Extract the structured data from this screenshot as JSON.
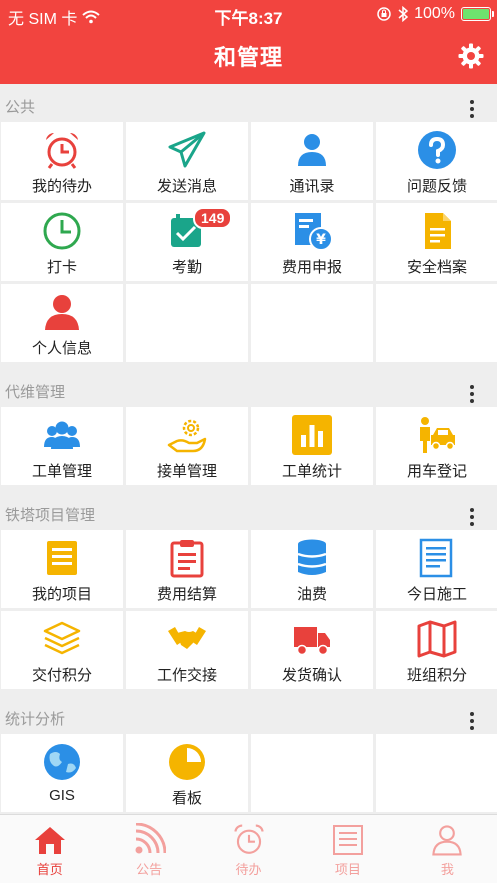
{
  "status_bar": {
    "carrier": "无 SIM 卡",
    "time": "下午8:37",
    "battery": "100%"
  },
  "header": {
    "title": "和管理"
  },
  "sections": [
    {
      "title": "公共",
      "items": [
        {
          "label": "我的待办",
          "icon": "alarm-clock-icon"
        },
        {
          "label": "发送消息",
          "icon": "paper-plane-icon"
        },
        {
          "label": "通讯录",
          "icon": "contact-person-icon"
        },
        {
          "label": "问题反馈",
          "icon": "question-icon"
        },
        {
          "label": "打卡",
          "icon": "clock-icon"
        },
        {
          "label": "考勤",
          "icon": "attendance-calendar-icon",
          "badge": "149"
        },
        {
          "label": "费用申报",
          "icon": "expense-report-icon"
        },
        {
          "label": "安全档案",
          "icon": "document-icon"
        },
        {
          "label": "个人信息",
          "icon": "person-icon"
        }
      ]
    },
    {
      "title": "代维管理",
      "items": [
        {
          "label": "工单管理",
          "icon": "group-icon"
        },
        {
          "label": "接单管理",
          "icon": "hand-gear-icon"
        },
        {
          "label": "工单统计",
          "icon": "bar-chart-icon"
        },
        {
          "label": "用车登记",
          "icon": "car-person-icon"
        }
      ]
    },
    {
      "title": "铁塔项目管理",
      "items": [
        {
          "label": "我的项目",
          "icon": "project-list-icon"
        },
        {
          "label": "费用结算",
          "icon": "clipboard-icon"
        },
        {
          "label": "油费",
          "icon": "oil-barrel-icon"
        },
        {
          "label": "今日施工",
          "icon": "notes-icon"
        },
        {
          "label": "交付积分",
          "icon": "layers-icon"
        },
        {
          "label": "工作交接",
          "icon": "handshake-icon"
        },
        {
          "label": "发货确认",
          "icon": "truck-icon"
        },
        {
          "label": "班组积分",
          "icon": "map-icon"
        }
      ]
    },
    {
      "title": "统计分析",
      "items": [
        {
          "label": "GIS",
          "icon": "globe-icon"
        },
        {
          "label": "看板",
          "icon": "pie-chart-icon"
        }
      ]
    }
  ],
  "tabs": [
    {
      "label": "首页",
      "icon": "home-icon",
      "active": true
    },
    {
      "label": "公告",
      "icon": "rss-icon",
      "active": false
    },
    {
      "label": "待办",
      "icon": "alarm-clock-icon",
      "active": false
    },
    {
      "label": "项目",
      "icon": "list-icon",
      "active": false
    },
    {
      "label": "我",
      "icon": "person-icon",
      "active": false
    }
  ],
  "colors": {
    "brand": "#f2443f",
    "blue": "#2b8fe6",
    "green": "#2fa84f",
    "yellow": "#f5b400",
    "teal": "#1aa58a",
    "red": "#e8413c"
  }
}
